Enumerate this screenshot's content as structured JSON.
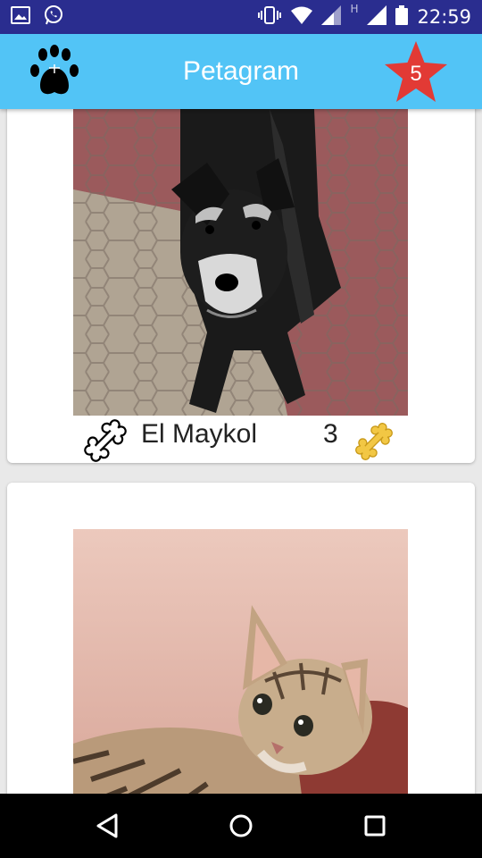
{
  "status_bar": {
    "time": "22:59",
    "network_label": "H",
    "icons": [
      "gallery-icon",
      "whatsapp-icon",
      "vibrate-icon",
      "wifi-icon",
      "signal-icon",
      "battery-icon"
    ]
  },
  "app_bar": {
    "title": "Petagram",
    "left_icon": "paw-icon",
    "right_icon": "star-icon",
    "favorites_count": "5",
    "color": "#52c4f6",
    "star_color": "#e23a35"
  },
  "pets": [
    {
      "name": "El Maykol",
      "rating": "3",
      "like_icon": "bone-outline-icon",
      "rating_icon": "bone-gold-icon",
      "photo": "dog-photo"
    },
    {
      "photo": "cat-photo"
    }
  ],
  "nav_bar": {
    "buttons": [
      "back-icon",
      "home-icon",
      "recents-icon"
    ]
  }
}
